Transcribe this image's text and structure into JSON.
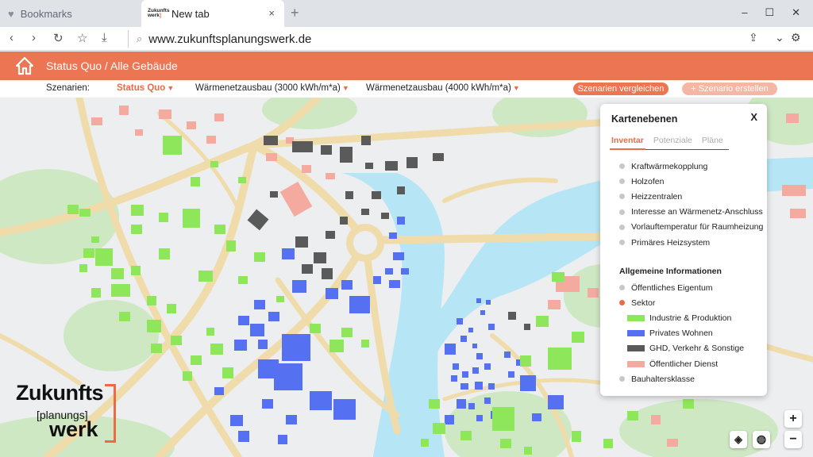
{
  "browser": {
    "tabs": [
      {
        "label": "Bookmarks",
        "icon": "heart-icon"
      },
      {
        "label": "New tab",
        "favicon_top": "Zukunfts",
        "favicon_bottom": "werk"
      }
    ],
    "tab_close": "×",
    "new_tab": "+",
    "window_controls": [
      "–",
      "☐",
      "✕"
    ],
    "url": "www.zukunftsplanungswerk.de"
  },
  "app": {
    "breadcrumb": "Status Quo / Alle Gebäude",
    "scenario_label": "Szenarien:",
    "scenarios": [
      {
        "label": "Status Quo",
        "active": true
      },
      {
        "label": "Wärmenetzausbau (3000 kWh/m*a)",
        "active": false
      },
      {
        "label": "Wärmenetzausbau (4000 kWh/m*a)",
        "active": false
      }
    ],
    "compare_button": "Szenarien vergleichen",
    "create_button": "+ Szenario erstellen",
    "accent": "#ec7654"
  },
  "panel": {
    "title": "Kartenebenen",
    "close": "X",
    "tabs": [
      "Inventar",
      "Potenziale",
      "Pläne"
    ],
    "inventory_items": [
      "Kraftwärmekopplung",
      "Holzofen",
      "Heizzentralen",
      "Interesse an Wärmenetz-Anschluss",
      "Vorlauftemperatur für Raumheizung",
      "Primäres Heizsystem"
    ],
    "general_title": "Allgemeine Informationen",
    "general_items": [
      {
        "label": "Öffentliches Eigentum",
        "type": "dot"
      },
      {
        "label": "Sektor",
        "type": "dot-active"
      },
      {
        "label": "Industrie & Produktion",
        "type": "swatch",
        "color": "#8ee65a"
      },
      {
        "label": "Privates Wohnen",
        "type": "swatch",
        "color": "#5570f0"
      },
      {
        "label": "GHD, Verkehr & Sonstige",
        "type": "swatch",
        "color": "#5a5a5a"
      },
      {
        "label": "Öffentlicher Dienst",
        "type": "swatch",
        "color": "#f5aaa0"
      },
      {
        "label": "Bauhaltersklasse",
        "type": "dot"
      }
    ]
  },
  "logo": {
    "line1": "Zukunfts",
    "line2": "[planungs]",
    "line3": "werk"
  },
  "map_controls": {
    "zoom_in": "+",
    "zoom_out": "−"
  },
  "colors": {
    "industry": "#8ee65a",
    "residential": "#5570f0",
    "commerce": "#5a5a5a",
    "public": "#f5aaa0",
    "water": "#b6e6f5",
    "road": "#f0dcaa",
    "green": "#cfe8c4"
  }
}
